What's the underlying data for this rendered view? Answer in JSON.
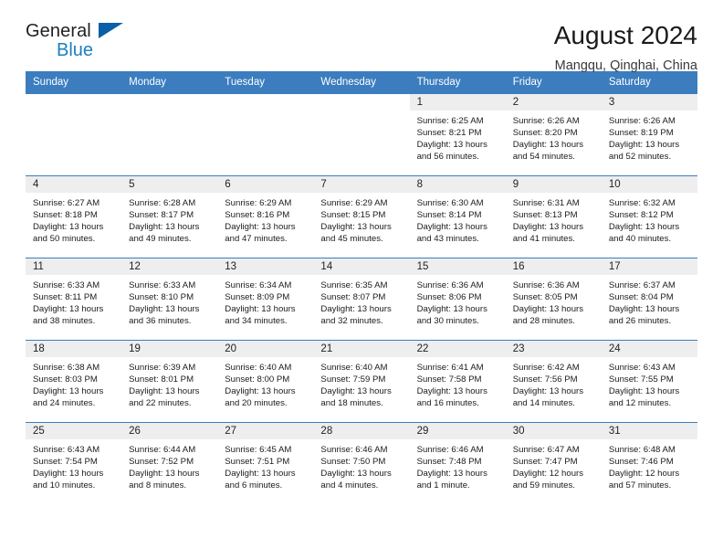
{
  "brand": {
    "name_part1": "General",
    "name_part2": "Blue",
    "triangle_color": "#0a5fa8",
    "blue_color": "#1a7fc1"
  },
  "header": {
    "title": "August 2024",
    "subtitle": "Mangqu, Qinghai, China"
  },
  "theme": {
    "header_row_bg": "#3b7dbf",
    "daynum_bg": "#eeeeee",
    "cell_border": "#3b7dbf"
  },
  "weekday_headers": [
    "Sunday",
    "Monday",
    "Tuesday",
    "Wednesday",
    "Thursday",
    "Friday",
    "Saturday"
  ],
  "weeks": [
    [
      {
        "day": "",
        "sunrise": "",
        "sunset": "",
        "daylight_line1": "",
        "daylight_line2": ""
      },
      {
        "day": "",
        "sunrise": "",
        "sunset": "",
        "daylight_line1": "",
        "daylight_line2": ""
      },
      {
        "day": "",
        "sunrise": "",
        "sunset": "",
        "daylight_line1": "",
        "daylight_line2": ""
      },
      {
        "day": "",
        "sunrise": "",
        "sunset": "",
        "daylight_line1": "",
        "daylight_line2": ""
      },
      {
        "day": "1",
        "sunrise": "Sunrise: 6:25 AM",
        "sunset": "Sunset: 8:21 PM",
        "daylight_line1": "Daylight: 13 hours",
        "daylight_line2": "and 56 minutes."
      },
      {
        "day": "2",
        "sunrise": "Sunrise: 6:26 AM",
        "sunset": "Sunset: 8:20 PM",
        "daylight_line1": "Daylight: 13 hours",
        "daylight_line2": "and 54 minutes."
      },
      {
        "day": "3",
        "sunrise": "Sunrise: 6:26 AM",
        "sunset": "Sunset: 8:19 PM",
        "daylight_line1": "Daylight: 13 hours",
        "daylight_line2": "and 52 minutes."
      }
    ],
    [
      {
        "day": "4",
        "sunrise": "Sunrise: 6:27 AM",
        "sunset": "Sunset: 8:18 PM",
        "daylight_line1": "Daylight: 13 hours",
        "daylight_line2": "and 50 minutes."
      },
      {
        "day": "5",
        "sunrise": "Sunrise: 6:28 AM",
        "sunset": "Sunset: 8:17 PM",
        "daylight_line1": "Daylight: 13 hours",
        "daylight_line2": "and 49 minutes."
      },
      {
        "day": "6",
        "sunrise": "Sunrise: 6:29 AM",
        "sunset": "Sunset: 8:16 PM",
        "daylight_line1": "Daylight: 13 hours",
        "daylight_line2": "and 47 minutes."
      },
      {
        "day": "7",
        "sunrise": "Sunrise: 6:29 AM",
        "sunset": "Sunset: 8:15 PM",
        "daylight_line1": "Daylight: 13 hours",
        "daylight_line2": "and 45 minutes."
      },
      {
        "day": "8",
        "sunrise": "Sunrise: 6:30 AM",
        "sunset": "Sunset: 8:14 PM",
        "daylight_line1": "Daylight: 13 hours",
        "daylight_line2": "and 43 minutes."
      },
      {
        "day": "9",
        "sunrise": "Sunrise: 6:31 AM",
        "sunset": "Sunset: 8:13 PM",
        "daylight_line1": "Daylight: 13 hours",
        "daylight_line2": "and 41 minutes."
      },
      {
        "day": "10",
        "sunrise": "Sunrise: 6:32 AM",
        "sunset": "Sunset: 8:12 PM",
        "daylight_line1": "Daylight: 13 hours",
        "daylight_line2": "and 40 minutes."
      }
    ],
    [
      {
        "day": "11",
        "sunrise": "Sunrise: 6:33 AM",
        "sunset": "Sunset: 8:11 PM",
        "daylight_line1": "Daylight: 13 hours",
        "daylight_line2": "and 38 minutes."
      },
      {
        "day": "12",
        "sunrise": "Sunrise: 6:33 AM",
        "sunset": "Sunset: 8:10 PM",
        "daylight_line1": "Daylight: 13 hours",
        "daylight_line2": "and 36 minutes."
      },
      {
        "day": "13",
        "sunrise": "Sunrise: 6:34 AM",
        "sunset": "Sunset: 8:09 PM",
        "daylight_line1": "Daylight: 13 hours",
        "daylight_line2": "and 34 minutes."
      },
      {
        "day": "14",
        "sunrise": "Sunrise: 6:35 AM",
        "sunset": "Sunset: 8:07 PM",
        "daylight_line1": "Daylight: 13 hours",
        "daylight_line2": "and 32 minutes."
      },
      {
        "day": "15",
        "sunrise": "Sunrise: 6:36 AM",
        "sunset": "Sunset: 8:06 PM",
        "daylight_line1": "Daylight: 13 hours",
        "daylight_line2": "and 30 minutes."
      },
      {
        "day": "16",
        "sunrise": "Sunrise: 6:36 AM",
        "sunset": "Sunset: 8:05 PM",
        "daylight_line1": "Daylight: 13 hours",
        "daylight_line2": "and 28 minutes."
      },
      {
        "day": "17",
        "sunrise": "Sunrise: 6:37 AM",
        "sunset": "Sunset: 8:04 PM",
        "daylight_line1": "Daylight: 13 hours",
        "daylight_line2": "and 26 minutes."
      }
    ],
    [
      {
        "day": "18",
        "sunrise": "Sunrise: 6:38 AM",
        "sunset": "Sunset: 8:03 PM",
        "daylight_line1": "Daylight: 13 hours",
        "daylight_line2": "and 24 minutes."
      },
      {
        "day": "19",
        "sunrise": "Sunrise: 6:39 AM",
        "sunset": "Sunset: 8:01 PM",
        "daylight_line1": "Daylight: 13 hours",
        "daylight_line2": "and 22 minutes."
      },
      {
        "day": "20",
        "sunrise": "Sunrise: 6:40 AM",
        "sunset": "Sunset: 8:00 PM",
        "daylight_line1": "Daylight: 13 hours",
        "daylight_line2": "and 20 minutes."
      },
      {
        "day": "21",
        "sunrise": "Sunrise: 6:40 AM",
        "sunset": "Sunset: 7:59 PM",
        "daylight_line1": "Daylight: 13 hours",
        "daylight_line2": "and 18 minutes."
      },
      {
        "day": "22",
        "sunrise": "Sunrise: 6:41 AM",
        "sunset": "Sunset: 7:58 PM",
        "daylight_line1": "Daylight: 13 hours",
        "daylight_line2": "and 16 minutes."
      },
      {
        "day": "23",
        "sunrise": "Sunrise: 6:42 AM",
        "sunset": "Sunset: 7:56 PM",
        "daylight_line1": "Daylight: 13 hours",
        "daylight_line2": "and 14 minutes."
      },
      {
        "day": "24",
        "sunrise": "Sunrise: 6:43 AM",
        "sunset": "Sunset: 7:55 PM",
        "daylight_line1": "Daylight: 13 hours",
        "daylight_line2": "and 12 minutes."
      }
    ],
    [
      {
        "day": "25",
        "sunrise": "Sunrise: 6:43 AM",
        "sunset": "Sunset: 7:54 PM",
        "daylight_line1": "Daylight: 13 hours",
        "daylight_line2": "and 10 minutes."
      },
      {
        "day": "26",
        "sunrise": "Sunrise: 6:44 AM",
        "sunset": "Sunset: 7:52 PM",
        "daylight_line1": "Daylight: 13 hours",
        "daylight_line2": "and 8 minutes."
      },
      {
        "day": "27",
        "sunrise": "Sunrise: 6:45 AM",
        "sunset": "Sunset: 7:51 PM",
        "daylight_line1": "Daylight: 13 hours",
        "daylight_line2": "and 6 minutes."
      },
      {
        "day": "28",
        "sunrise": "Sunrise: 6:46 AM",
        "sunset": "Sunset: 7:50 PM",
        "daylight_line1": "Daylight: 13 hours",
        "daylight_line2": "and 4 minutes."
      },
      {
        "day": "29",
        "sunrise": "Sunrise: 6:46 AM",
        "sunset": "Sunset: 7:48 PM",
        "daylight_line1": "Daylight: 13 hours",
        "daylight_line2": "and 1 minute."
      },
      {
        "day": "30",
        "sunrise": "Sunrise: 6:47 AM",
        "sunset": "Sunset: 7:47 PM",
        "daylight_line1": "Daylight: 12 hours",
        "daylight_line2": "and 59 minutes."
      },
      {
        "day": "31",
        "sunrise": "Sunrise: 6:48 AM",
        "sunset": "Sunset: 7:46 PM",
        "daylight_line1": "Daylight: 12 hours",
        "daylight_line2": "and 57 minutes."
      }
    ]
  ]
}
